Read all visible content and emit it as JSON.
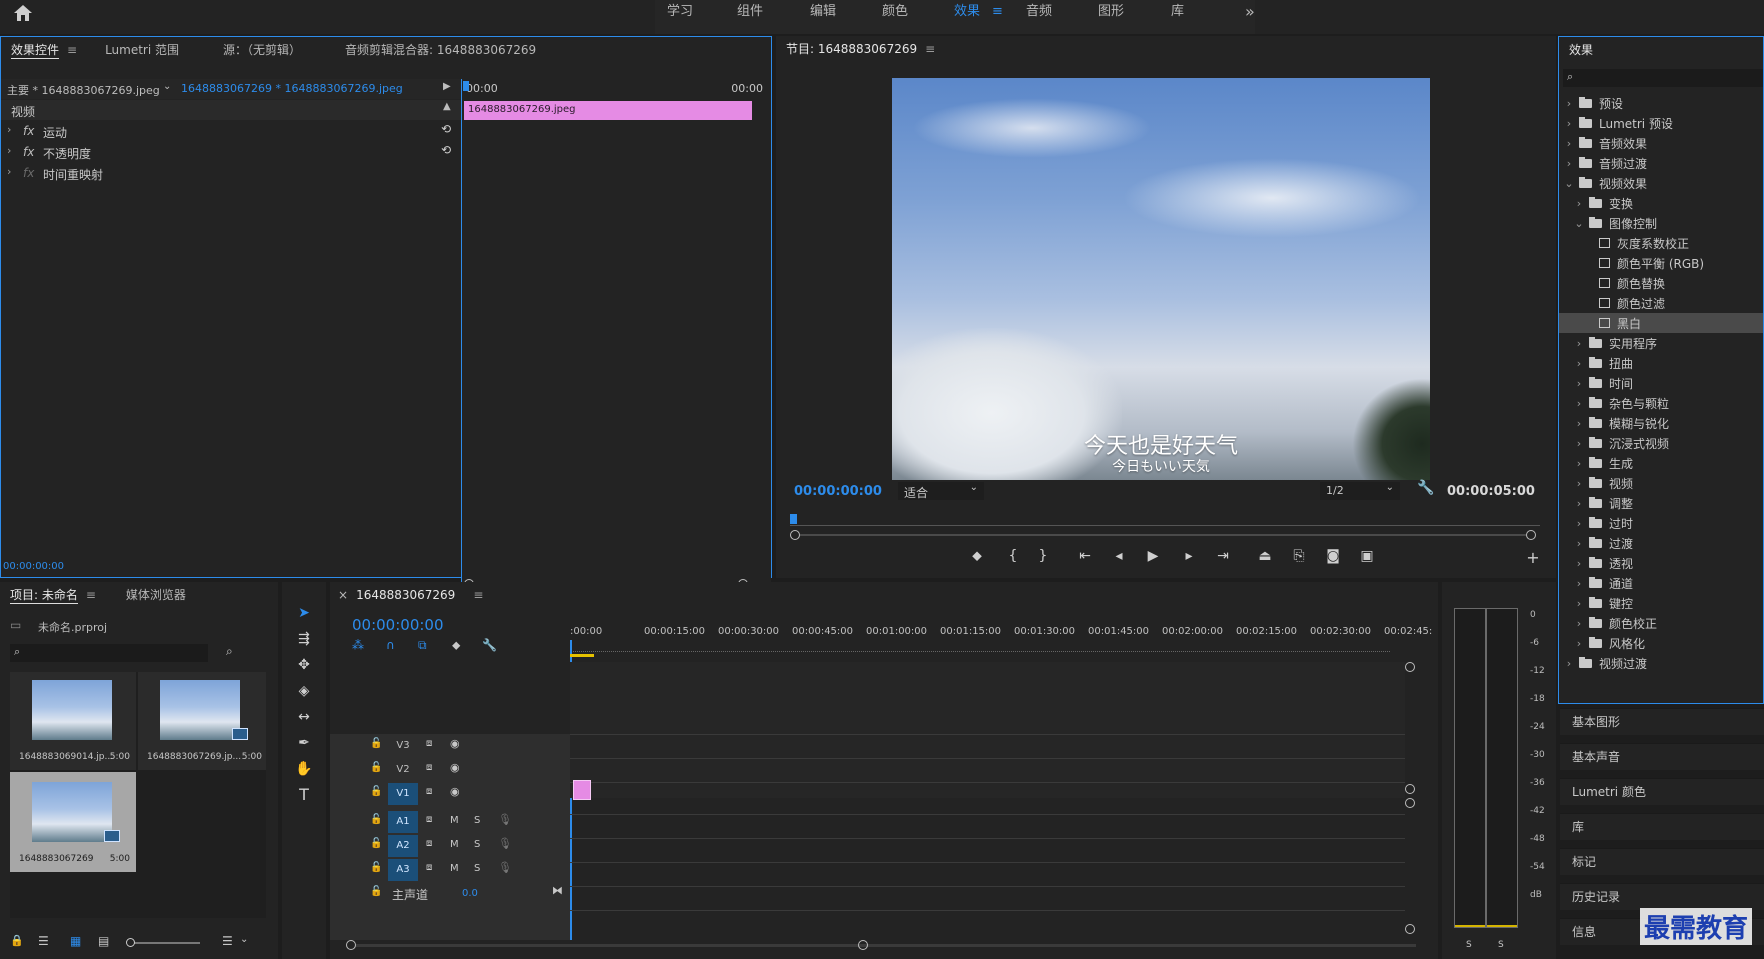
{
  "workspaces": {
    "items": [
      "学习",
      "组件",
      "编辑",
      "颜色",
      "效果",
      "音频",
      "图形",
      "库"
    ],
    "active": "效果",
    "active_menu": "≡",
    "more": "»"
  },
  "effect_controls": {
    "tabs": [
      "效果控件",
      "Lumetri 范围",
      "源：（无剪辑）",
      "音频剪辑混合器: 1648883067269"
    ],
    "active_menu": "≡",
    "master_label": "主要 * 1648883067269.jpeg",
    "sequence_clip": "1648883067269 * 1648883067269.jpeg",
    "time_start": "00:00",
    "time_end": "00:00",
    "clip_name": "1648883067269.jpeg",
    "section": "视频",
    "properties": [
      "运动",
      "不透明度",
      "时间重映射"
    ],
    "fx_label": "fx",
    "timecode": "00:00:00:00"
  },
  "program_monitor": {
    "title": "节目: 1648883067269",
    "menu": "≡",
    "current_time": "00:00:00:00",
    "fit": "适合",
    "quality": "1/2",
    "duration": "00:00:05:00",
    "caption_main": "今天也是好天气",
    "caption_sub": "今日もいい天気"
  },
  "effects_panel": {
    "title": "效果",
    "search_icon": "search-icon",
    "tree": [
      {
        "label": "预设",
        "level": 0,
        "open": false,
        "type": "folder"
      },
      {
        "label": "Lumetri 预设",
        "level": 0,
        "open": false,
        "type": "folder"
      },
      {
        "label": "音频效果",
        "level": 0,
        "open": false,
        "type": "folder"
      },
      {
        "label": "音频过渡",
        "level": 0,
        "open": false,
        "type": "folder"
      },
      {
        "label": "视频效果",
        "level": 0,
        "open": true,
        "type": "folder"
      },
      {
        "label": "变换",
        "level": 1,
        "open": false,
        "type": "folder"
      },
      {
        "label": "图像控制",
        "level": 1,
        "open": true,
        "type": "folder"
      },
      {
        "label": "灰度系数校正",
        "level": 2,
        "type": "effect"
      },
      {
        "label": "颜色平衡 (RGB)",
        "level": 2,
        "type": "effect"
      },
      {
        "label": "颜色替换",
        "level": 2,
        "type": "effect"
      },
      {
        "label": "颜色过滤",
        "level": 2,
        "type": "effect"
      },
      {
        "label": "黑白",
        "level": 2,
        "type": "effect",
        "selected": true
      },
      {
        "label": "实用程序",
        "level": 1,
        "open": false,
        "type": "folder"
      },
      {
        "label": "扭曲",
        "level": 1,
        "open": false,
        "type": "folder"
      },
      {
        "label": "时间",
        "level": 1,
        "open": false,
        "type": "folder"
      },
      {
        "label": "杂色与颗粒",
        "level": 1,
        "open": false,
        "type": "folder"
      },
      {
        "label": "模糊与锐化",
        "level": 1,
        "open": false,
        "type": "folder"
      },
      {
        "label": "沉浸式视频",
        "level": 1,
        "open": false,
        "type": "folder"
      },
      {
        "label": "生成",
        "level": 1,
        "open": false,
        "type": "folder"
      },
      {
        "label": "视频",
        "level": 1,
        "open": false,
        "type": "folder"
      },
      {
        "label": "调整",
        "level": 1,
        "open": false,
        "type": "folder"
      },
      {
        "label": "过时",
        "level": 1,
        "open": false,
        "type": "folder"
      },
      {
        "label": "过渡",
        "level": 1,
        "open": false,
        "type": "folder"
      },
      {
        "label": "透视",
        "level": 1,
        "open": false,
        "type": "folder"
      },
      {
        "label": "通道",
        "level": 1,
        "open": false,
        "type": "folder"
      },
      {
        "label": "键控",
        "level": 1,
        "open": false,
        "type": "folder"
      },
      {
        "label": "颜色校正",
        "level": 1,
        "open": false,
        "type": "folder"
      },
      {
        "label": "风格化",
        "level": 1,
        "open": false,
        "type": "folder"
      },
      {
        "label": "视频过渡",
        "level": 0,
        "open": false,
        "type": "folder"
      }
    ]
  },
  "side_panels": [
    "基本图形",
    "基本声音",
    "Lumetri 颜色",
    "库",
    "标记",
    "历史记录",
    "信息"
  ],
  "project_panel": {
    "tabs": [
      "项目: 未命名",
      "媒体浏览器"
    ],
    "menu": "≡",
    "project_file": "未命名.prproj",
    "items": [
      {
        "name": "1648883069014.jp...",
        "duration": "5:00"
      },
      {
        "name": "1648883067269.jp...",
        "duration": "5:00"
      },
      {
        "name": "1648883067269",
        "duration": "5:00"
      }
    ]
  },
  "timeline": {
    "tab": "1648883067269",
    "close": "×",
    "menu": "≡",
    "timecode": "00:00:00:00",
    "ruler": [
      ":00:00",
      "00:00:15:00",
      "00:00:30:00",
      "00:00:45:00",
      "00:01:00:00",
      "00:01:15:00",
      "00:01:30:00",
      "00:01:45:00",
      "00:02:00:00",
      "00:02:15:00",
      "00:02:30:00",
      "00:02:45:"
    ],
    "video_tracks": [
      "V3",
      "V2",
      "V1"
    ],
    "audio_tracks": [
      "A1",
      "A2",
      "A3"
    ],
    "m_label": "M",
    "s_label": "S",
    "master_label": "主声道",
    "master_value": "0.0"
  },
  "audio_meter": {
    "scale": [
      "0",
      "-6",
      "-12",
      "-18",
      "-24",
      "-30",
      "-36",
      "-42",
      "-48",
      "-54",
      "dB"
    ],
    "solo": [
      "S",
      "S"
    ]
  },
  "watermark": "最需教育",
  "colors": {
    "accent": "#2d8ceb",
    "clip": "#e58be4",
    "panel": "#232323",
    "track_on": "#1b4f79"
  }
}
